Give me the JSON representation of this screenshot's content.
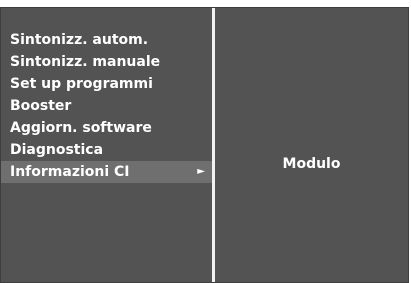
{
  "menu": {
    "items": [
      {
        "label": "Sintonizz. autom."
      },
      {
        "label": "Sintonizz. manuale"
      },
      {
        "label": "Set up programmi"
      },
      {
        "label": "Booster"
      },
      {
        "label": "Aggiorn. software"
      },
      {
        "label": "Diagnostica"
      },
      {
        "label": "Informazioni CI",
        "arrow": "►"
      }
    ]
  },
  "submenu": {
    "items": [
      {
        "label": "Modulo"
      }
    ]
  },
  "colors": {
    "panel_background": "#535353",
    "highlight": "#6f6f6f",
    "divider": "#f2f2f2",
    "text": "#ffffff"
  }
}
